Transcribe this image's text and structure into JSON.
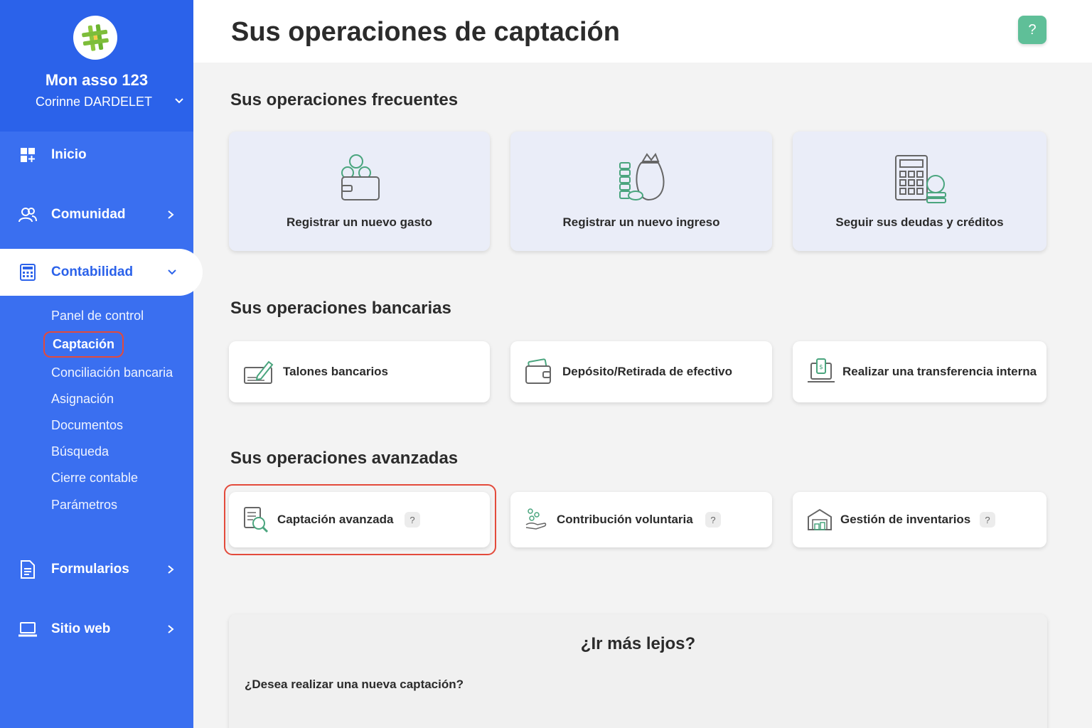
{
  "sidebar": {
    "org_name": "Mon asso 123",
    "user_name": "Corinne DARDELET",
    "nav": {
      "inicio": "Inicio",
      "comunidad": "Comunidad",
      "contabilidad": "Contabilidad",
      "formularios": "Formularios",
      "sitio_web": "Sitio web"
    },
    "sub_items": [
      "Panel de control",
      "Captación",
      "Conciliación bancaria",
      "Asignación",
      "Documentos",
      "Búsqueda",
      "Cierre contable",
      "Parámetros"
    ],
    "current_sub_item": "Captación"
  },
  "header": {
    "title": "Sus operaciones de captación",
    "help_label": "?"
  },
  "frequent": {
    "title": "Sus operaciones frecuentes",
    "cards": [
      {
        "label": "Registrar un nuevo gasto",
        "icon": "wallet-coins-icon"
      },
      {
        "label": "Registrar un nuevo ingreso",
        "icon": "money-bag-icon"
      },
      {
        "label": "Seguir sus deudas y créditos",
        "icon": "calculator-coins-icon"
      }
    ]
  },
  "bank": {
    "title": "Sus operaciones bancarias",
    "cards": [
      {
        "label": "Talones bancarios",
        "icon": "cheque-pen-icon"
      },
      {
        "label": "Depósito/Retirada de efectivo",
        "icon": "cash-wallet-icon"
      },
      {
        "label": "Realizar una transferencia interna",
        "icon": "laptop-transfer-icon"
      }
    ]
  },
  "advanced": {
    "title": "Sus operaciones avanzadas",
    "cards": [
      {
        "label": "Captación avanzada",
        "icon": "document-search-icon",
        "help": "?"
      },
      {
        "label": "Contribución voluntaria",
        "icon": "hand-coins-icon",
        "help": "?"
      },
      {
        "label": "Gestión de inventarios",
        "icon": "warehouse-icon",
        "help": "?"
      }
    ]
  },
  "further": {
    "title": "¿Ir más lejos?",
    "question": "¿Desea realizar una nueva captación?"
  },
  "colors": {
    "sidebar": "#3a6ff0",
    "sidebar_top": "#2b62ea",
    "accent_green": "#5fbf98",
    "highlight_red": "#e34a3b"
  }
}
